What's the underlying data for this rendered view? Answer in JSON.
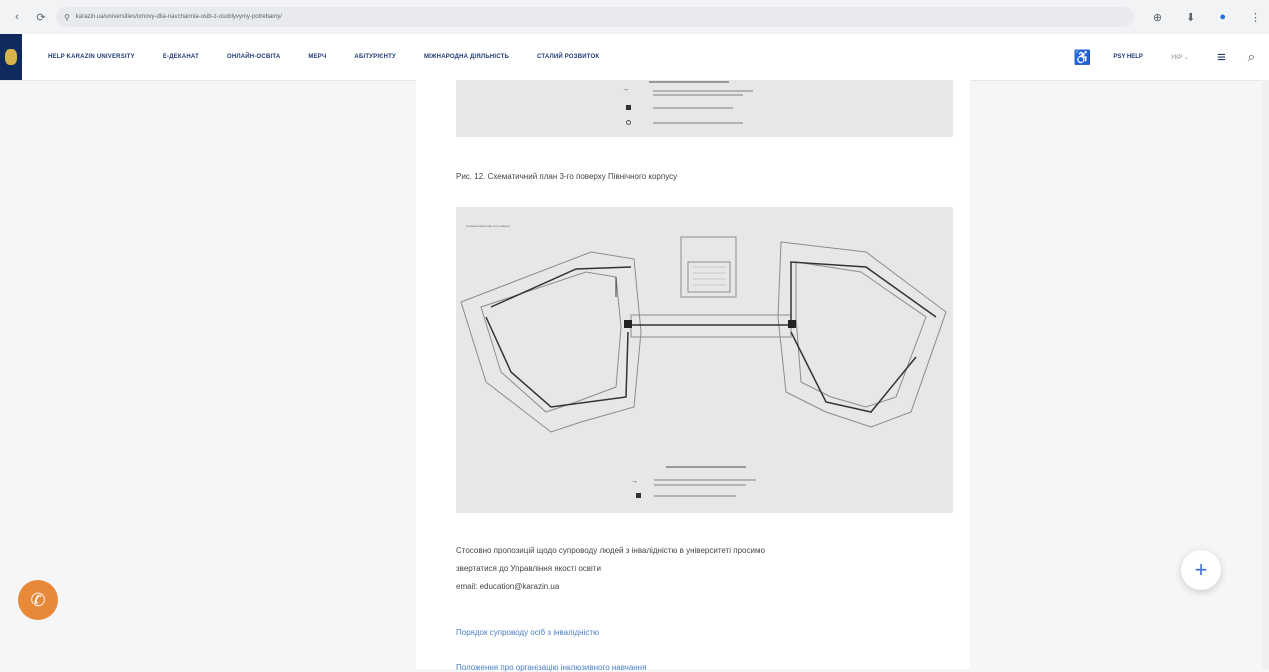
{
  "browser": {
    "back_glyph": "‹",
    "reload_glyph": "⟳",
    "site_info_glyph": "⚲",
    "url": "karazin.ua/universities/umovy-dlia-navchannia-osib-z-osoblyvymy-potrebamy/",
    "extension_glyph": "⊕",
    "download_glyph": "⬇",
    "profile_glyph": "●",
    "menu_glyph": "⋮"
  },
  "nav": {
    "items": [
      "HELP KARAZIN UNIVERSITY",
      "Е-ДЕКАНАТ",
      "ОНЛАЙН-ОСВІТА",
      "МЕРЧ",
      "АБІТУРІЄНТУ",
      "МІЖНАРОДНА ДІЯЛЬНІСТЬ",
      "СТАЛИЙ РОЗВИТОК"
    ],
    "accessibility_glyph": "♿",
    "psy_help": "PSY HELP",
    "language": "УКР ⌄",
    "menu_glyph": "≡",
    "search_glyph": "⌕"
  },
  "content": {
    "caption": "Рис. 12. Схематичний план 3-го поверху Північного корпусу",
    "map_label": "Схематичний план 3-го поверху",
    "legend_title": "Умовні позначення",
    "paragraph": [
      "Стосовно пропозицій щодо супроводу людей з інвалідністю в університеті просимо",
      "звертатися до Управління якості освіти",
      "email: education@karazin.ua"
    ],
    "link1": "Порядок супроводу осіб з інвалідністю",
    "link2": "Положення про організацію інклюзивного навчання"
  },
  "floating": {
    "phone_glyph": "✆",
    "plus_glyph": "+"
  }
}
